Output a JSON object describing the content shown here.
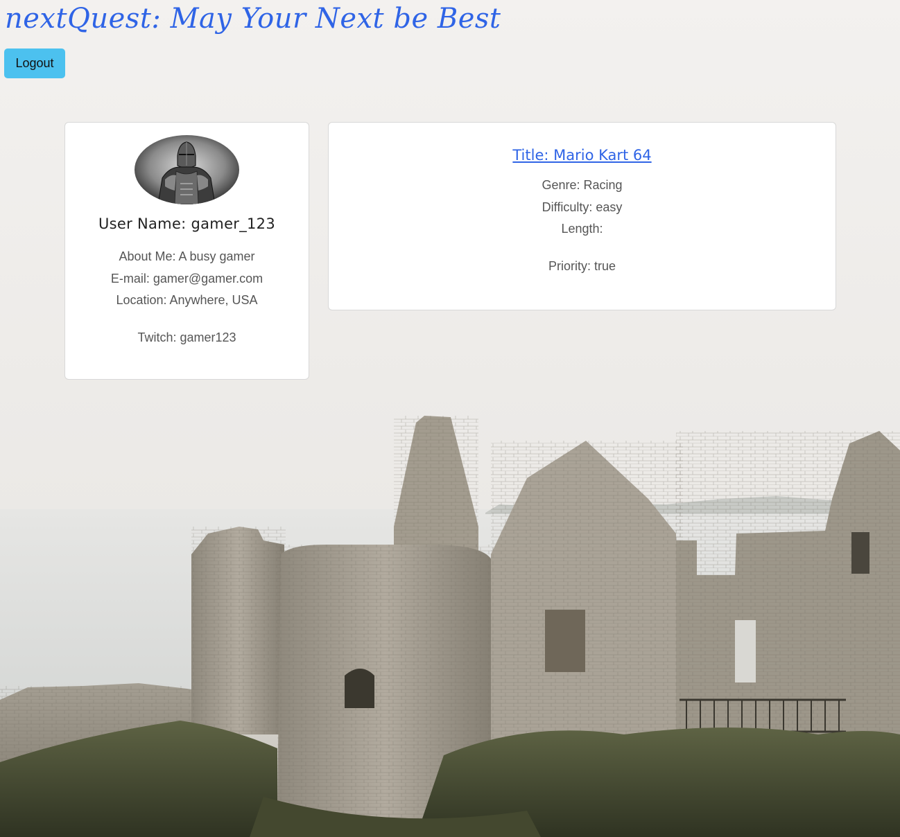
{
  "header": {
    "title": "nextQuest: May Your Next be Best",
    "logout_label": "Logout"
  },
  "profile": {
    "user_name": "User Name: gamer_123",
    "about": "About Me: A busy gamer",
    "email": "E-mail: gamer@gamer.com",
    "location": "Location: Anywhere, USA",
    "twitch": "Twitch: gamer123",
    "avatar_icon": "knight-armor-avatar"
  },
  "game": {
    "title": "Title: Mario Kart 64",
    "genre": "Genre: Racing",
    "difficulty": "Difficulty: easy",
    "length": "Length:",
    "priority": "Priority: true"
  },
  "colors": {
    "title": "#2f64e6",
    "logout_button": "#4cc1ef",
    "card_bg": "#ffffff",
    "muted_text": "#555555"
  },
  "background": {
    "icon": "castle-ruins-on-coast-image"
  }
}
